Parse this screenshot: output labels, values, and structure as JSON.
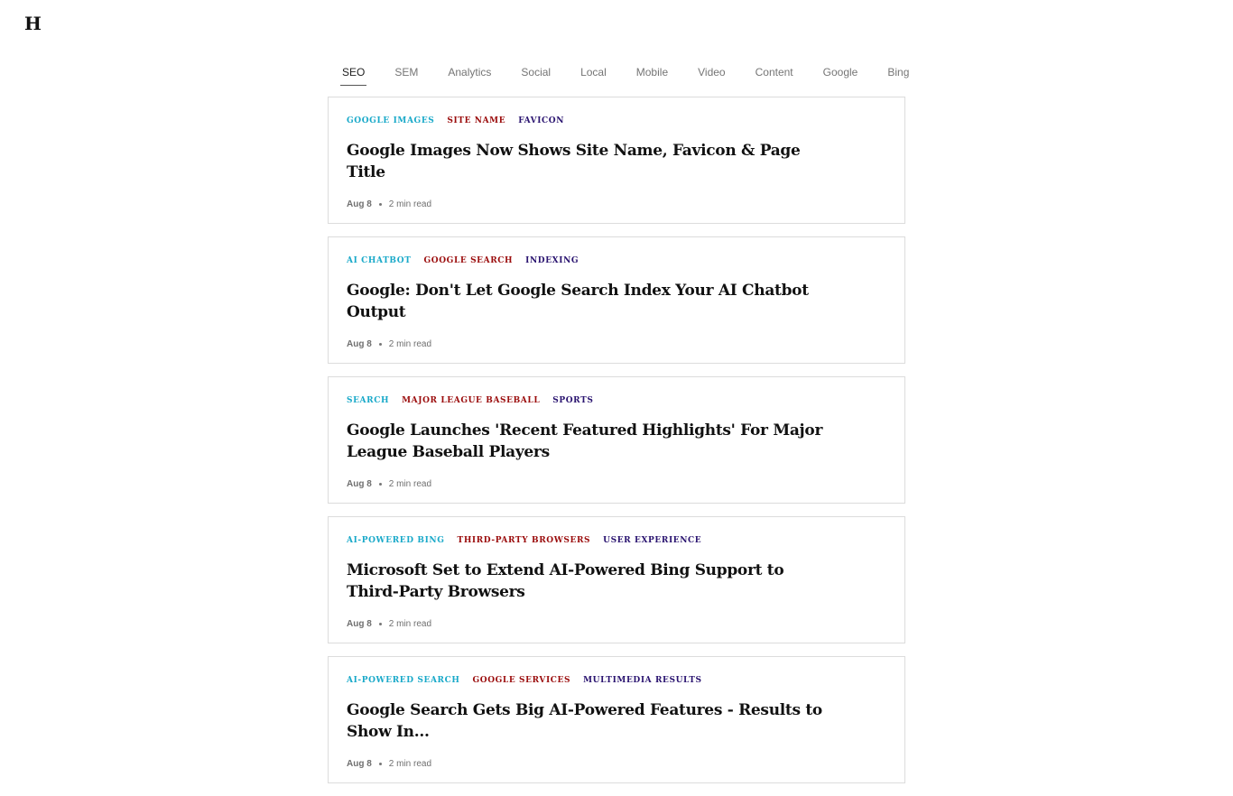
{
  "logo": "H",
  "tabs": [
    "SEO",
    "SEM",
    "Analytics",
    "Social",
    "Local",
    "Mobile",
    "Video",
    "Content",
    "Google",
    "Bing"
  ],
  "active_tab": "SEO",
  "tag_colors": [
    "#19a9c9",
    "#9b0d0d",
    "#2a1470"
  ],
  "articles": [
    {
      "tags": [
        "GOOGLE IMAGES",
        "SITE NAME",
        "FAVICON"
      ],
      "title": "Google Images Now Shows Site Name, Favicon & Page Title",
      "date": "Aug 8",
      "read_time": "2 min read"
    },
    {
      "tags": [
        "AI CHATBOT",
        "GOOGLE SEARCH",
        "INDEXING"
      ],
      "title": "Google: Don't Let Google Search Index Your AI Chatbot Output",
      "date": "Aug 8",
      "read_time": "2 min read"
    },
    {
      "tags": [
        "SEARCH",
        "MAJOR LEAGUE BASEBALL",
        "SPORTS"
      ],
      "title": "Google Launches 'Recent Featured Highlights' For Major League Baseball Players",
      "date": "Aug 8",
      "read_time": "2 min read"
    },
    {
      "tags": [
        "AI-POWERED BING",
        "THIRD-PARTY BROWSERS",
        "USER EXPERIENCE"
      ],
      "title": "Microsoft Set to Extend AI-Powered Bing Support to Third-Party Browsers",
      "date": "Aug 8",
      "read_time": "2 min read"
    },
    {
      "tags": [
        "AI-POWERED SEARCH",
        "GOOGLE SERVICES",
        "MULTIMEDIA RESULTS"
      ],
      "title": "Google Search Gets Big AI-Powered Features - Results to Show In...",
      "date": "Aug 8",
      "read_time": "2 min read"
    }
  ]
}
